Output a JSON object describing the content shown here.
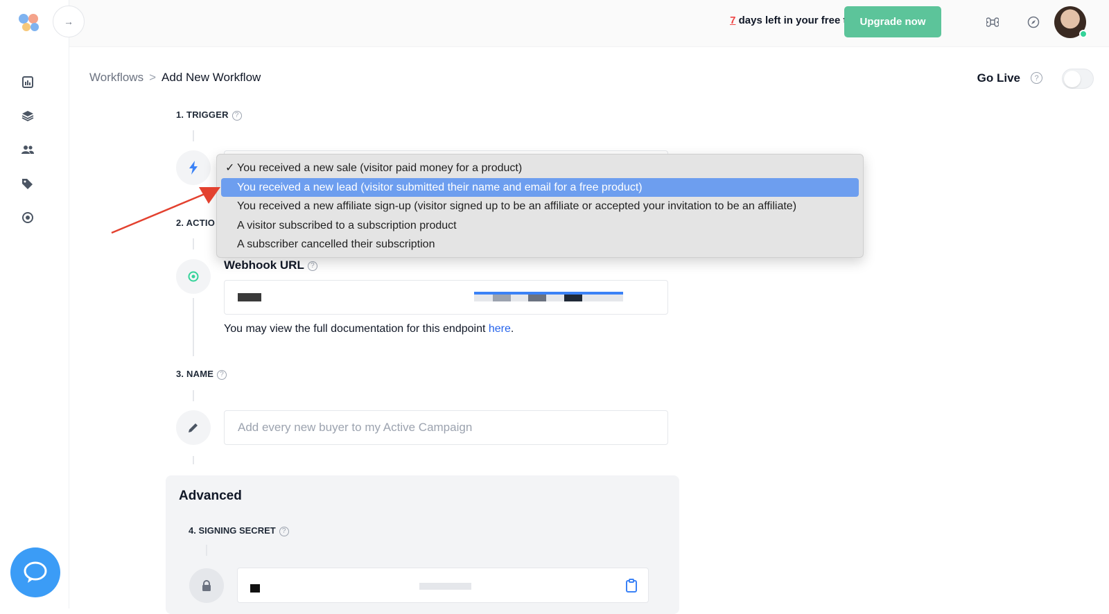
{
  "header": {
    "trial_days": "7",
    "trial_text": " days left in your free trial",
    "upgrade_label": "Upgrade now"
  },
  "breadcrumb": {
    "parent": "Workflows",
    "separator": ">",
    "current": "Add New Workflow"
  },
  "golive": {
    "label": "Go Live",
    "enabled": false
  },
  "steps": {
    "trigger": {
      "label": "1. TRIGGER"
    },
    "action": {
      "label": "2. ACTIO",
      "webhook_label": "Webhook URL",
      "doc_text": "You may view the full documentation for this endpoint ",
      "doc_link": "here",
      "doc_end": "."
    },
    "name": {
      "label": "3. NAME",
      "placeholder": "Add every new buyer to my Active Campaign"
    }
  },
  "advanced": {
    "title": "Advanced",
    "signing_label": "4. SIGNING SECRET"
  },
  "dropdown": {
    "options": [
      {
        "label": "You received a new sale (visitor paid money for a product)",
        "checked": true,
        "highlighted": false
      },
      {
        "label": "You received a new lead (visitor submitted their name and email for a free product)",
        "checked": false,
        "highlighted": true
      },
      {
        "label": "You received a new affiliate sign-up (visitor signed up to be an affiliate or accepted your invitation to be an affiliate)",
        "checked": false,
        "highlighted": false
      },
      {
        "label": "A visitor subscribed to a subscription product",
        "checked": false,
        "highlighted": false
      },
      {
        "label": "A subscriber cancelled their subscription",
        "checked": false,
        "highlighted": false
      }
    ],
    "check_glyph": "✓"
  },
  "icons": {
    "sidebar": [
      "dashboard-icon",
      "layers-icon",
      "users-icon",
      "tags-icon",
      "workflows-icon"
    ],
    "top": [
      "command-icon",
      "compass-icon"
    ]
  },
  "colors": {
    "accent": "#5cc49a",
    "highlight": "#6d9eef",
    "chat": "#3b9cf6",
    "arrow": "#e3412f"
  }
}
